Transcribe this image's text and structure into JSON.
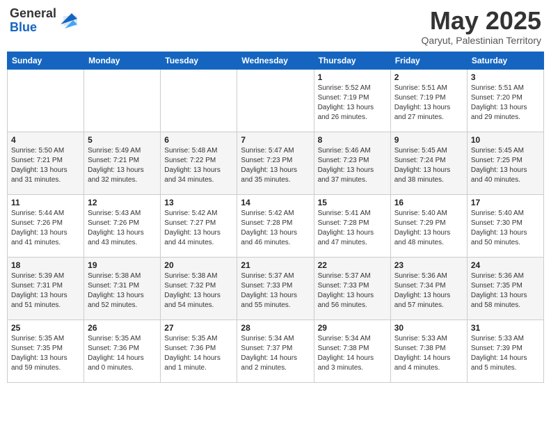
{
  "header": {
    "logo_line1": "General",
    "logo_line2": "Blue",
    "month_title": "May 2025",
    "location": "Qaryut, Palestinian Territory"
  },
  "weekdays": [
    "Sunday",
    "Monday",
    "Tuesday",
    "Wednesday",
    "Thursday",
    "Friday",
    "Saturday"
  ],
  "weeks": [
    [
      {
        "day": "",
        "detail": ""
      },
      {
        "day": "",
        "detail": ""
      },
      {
        "day": "",
        "detail": ""
      },
      {
        "day": "",
        "detail": ""
      },
      {
        "day": "1",
        "detail": "Sunrise: 5:52 AM\nSunset: 7:19 PM\nDaylight: 13 hours\nand 26 minutes."
      },
      {
        "day": "2",
        "detail": "Sunrise: 5:51 AM\nSunset: 7:19 PM\nDaylight: 13 hours\nand 27 minutes."
      },
      {
        "day": "3",
        "detail": "Sunrise: 5:51 AM\nSunset: 7:20 PM\nDaylight: 13 hours\nand 29 minutes."
      }
    ],
    [
      {
        "day": "4",
        "detail": "Sunrise: 5:50 AM\nSunset: 7:21 PM\nDaylight: 13 hours\nand 31 minutes."
      },
      {
        "day": "5",
        "detail": "Sunrise: 5:49 AM\nSunset: 7:21 PM\nDaylight: 13 hours\nand 32 minutes."
      },
      {
        "day": "6",
        "detail": "Sunrise: 5:48 AM\nSunset: 7:22 PM\nDaylight: 13 hours\nand 34 minutes."
      },
      {
        "day": "7",
        "detail": "Sunrise: 5:47 AM\nSunset: 7:23 PM\nDaylight: 13 hours\nand 35 minutes."
      },
      {
        "day": "8",
        "detail": "Sunrise: 5:46 AM\nSunset: 7:23 PM\nDaylight: 13 hours\nand 37 minutes."
      },
      {
        "day": "9",
        "detail": "Sunrise: 5:45 AM\nSunset: 7:24 PM\nDaylight: 13 hours\nand 38 minutes."
      },
      {
        "day": "10",
        "detail": "Sunrise: 5:45 AM\nSunset: 7:25 PM\nDaylight: 13 hours\nand 40 minutes."
      }
    ],
    [
      {
        "day": "11",
        "detail": "Sunrise: 5:44 AM\nSunset: 7:26 PM\nDaylight: 13 hours\nand 41 minutes."
      },
      {
        "day": "12",
        "detail": "Sunrise: 5:43 AM\nSunset: 7:26 PM\nDaylight: 13 hours\nand 43 minutes."
      },
      {
        "day": "13",
        "detail": "Sunrise: 5:42 AM\nSunset: 7:27 PM\nDaylight: 13 hours\nand 44 minutes."
      },
      {
        "day": "14",
        "detail": "Sunrise: 5:42 AM\nSunset: 7:28 PM\nDaylight: 13 hours\nand 46 minutes."
      },
      {
        "day": "15",
        "detail": "Sunrise: 5:41 AM\nSunset: 7:28 PM\nDaylight: 13 hours\nand 47 minutes."
      },
      {
        "day": "16",
        "detail": "Sunrise: 5:40 AM\nSunset: 7:29 PM\nDaylight: 13 hours\nand 48 minutes."
      },
      {
        "day": "17",
        "detail": "Sunrise: 5:40 AM\nSunset: 7:30 PM\nDaylight: 13 hours\nand 50 minutes."
      }
    ],
    [
      {
        "day": "18",
        "detail": "Sunrise: 5:39 AM\nSunset: 7:31 PM\nDaylight: 13 hours\nand 51 minutes."
      },
      {
        "day": "19",
        "detail": "Sunrise: 5:38 AM\nSunset: 7:31 PM\nDaylight: 13 hours\nand 52 minutes."
      },
      {
        "day": "20",
        "detail": "Sunrise: 5:38 AM\nSunset: 7:32 PM\nDaylight: 13 hours\nand 54 minutes."
      },
      {
        "day": "21",
        "detail": "Sunrise: 5:37 AM\nSunset: 7:33 PM\nDaylight: 13 hours\nand 55 minutes."
      },
      {
        "day": "22",
        "detail": "Sunrise: 5:37 AM\nSunset: 7:33 PM\nDaylight: 13 hours\nand 56 minutes."
      },
      {
        "day": "23",
        "detail": "Sunrise: 5:36 AM\nSunset: 7:34 PM\nDaylight: 13 hours\nand 57 minutes."
      },
      {
        "day": "24",
        "detail": "Sunrise: 5:36 AM\nSunset: 7:35 PM\nDaylight: 13 hours\nand 58 minutes."
      }
    ],
    [
      {
        "day": "25",
        "detail": "Sunrise: 5:35 AM\nSunset: 7:35 PM\nDaylight: 13 hours\nand 59 minutes."
      },
      {
        "day": "26",
        "detail": "Sunrise: 5:35 AM\nSunset: 7:36 PM\nDaylight: 14 hours\nand 0 minutes."
      },
      {
        "day": "27",
        "detail": "Sunrise: 5:35 AM\nSunset: 7:36 PM\nDaylight: 14 hours\nand 1 minute."
      },
      {
        "day": "28",
        "detail": "Sunrise: 5:34 AM\nSunset: 7:37 PM\nDaylight: 14 hours\nand 2 minutes."
      },
      {
        "day": "29",
        "detail": "Sunrise: 5:34 AM\nSunset: 7:38 PM\nDaylight: 14 hours\nand 3 minutes."
      },
      {
        "day": "30",
        "detail": "Sunrise: 5:33 AM\nSunset: 7:38 PM\nDaylight: 14 hours\nand 4 minutes."
      },
      {
        "day": "31",
        "detail": "Sunrise: 5:33 AM\nSunset: 7:39 PM\nDaylight: 14 hours\nand 5 minutes."
      }
    ]
  ]
}
